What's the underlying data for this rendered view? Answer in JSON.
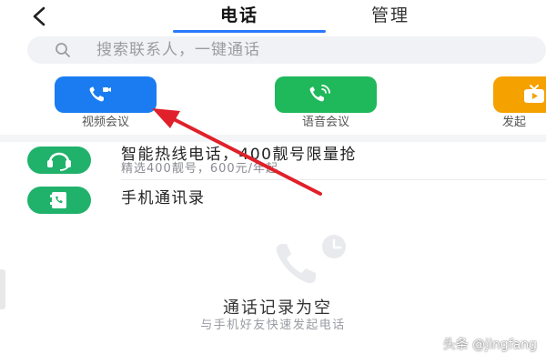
{
  "header": {
    "tabs": [
      {
        "label": "电话",
        "active": true
      },
      {
        "label": "管理",
        "active": false
      }
    ]
  },
  "search": {
    "placeholder": "搜索联系人，一键通话"
  },
  "features": [
    {
      "label": "视频会议",
      "icon": "video-call-icon",
      "color": "#1a7cf0"
    },
    {
      "label": "语音会议",
      "icon": "voice-call-icon",
      "color": "#1fb85a"
    },
    {
      "label": "发起",
      "icon": "live-icon",
      "color": "#f5a100"
    }
  ],
  "list": [
    {
      "title": "智能热线电话，400靓号限量抢",
      "subtitle": "精选400靓号，600元/年起",
      "icon": "headset-icon"
    },
    {
      "title": "手机通讯录",
      "icon": "contacts-icon"
    }
  ],
  "empty_state": {
    "title": "通话记录为空",
    "subtitle": "与手机好友快速发起电话"
  },
  "watermark": "头条 @jingfang",
  "colors": {
    "accent": "#2a79ff",
    "green": "#20b26b",
    "annotation_arrow": "#e0202a"
  }
}
